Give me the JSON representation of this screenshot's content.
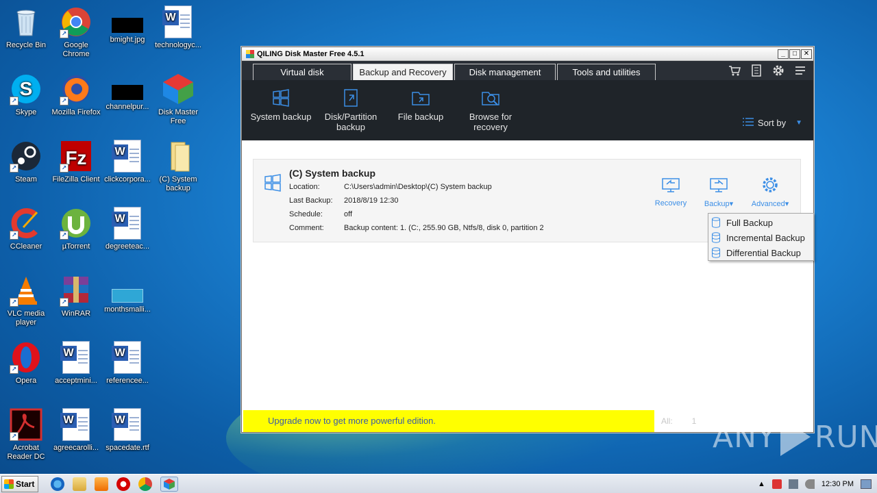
{
  "desktop": {
    "icons": [
      {
        "label": "Recycle Bin",
        "icon": "recycle-bin-icon"
      },
      {
        "label": "Google Chrome",
        "icon": "chrome-icon"
      },
      {
        "label": "bmight.jpg",
        "icon": "image-file-icon"
      },
      {
        "label": "technologyc...",
        "icon": "word-doc-icon"
      },
      {
        "label": "Skype",
        "icon": "skype-icon"
      },
      {
        "label": "Mozilla Firefox",
        "icon": "firefox-icon"
      },
      {
        "label": "channelpur...",
        "icon": "image-file-icon"
      },
      {
        "label": "Disk Master Free",
        "icon": "disk-master-icon"
      },
      {
        "label": "Steam",
        "icon": "steam-icon"
      },
      {
        "label": "FileZilla Client",
        "icon": "filezilla-icon"
      },
      {
        "label": "clickcorpora...",
        "icon": "word-doc-icon"
      },
      {
        "label": "(C) System backup",
        "icon": "folder-icon"
      },
      {
        "label": "CCleaner",
        "icon": "ccleaner-icon"
      },
      {
        "label": "µTorrent",
        "icon": "utorrent-icon"
      },
      {
        "label": "degreeteac...",
        "icon": "word-doc-icon"
      },
      {
        "label": "VLC media player",
        "icon": "vlc-icon"
      },
      {
        "label": "WinRAR",
        "icon": "winrar-icon"
      },
      {
        "label": "monthsmalli...",
        "icon": "image-file-icon"
      },
      {
        "label": "Opera",
        "icon": "opera-icon"
      },
      {
        "label": "acceptmini...",
        "icon": "word-doc-icon"
      },
      {
        "label": "referencee...",
        "icon": "word-doc-icon"
      },
      {
        "label": "Acrobat Reader DC",
        "icon": "acrobat-icon"
      },
      {
        "label": "agreecarolli...",
        "icon": "word-doc-icon"
      },
      {
        "label": "spacedate.rtf",
        "icon": "word-doc-icon"
      }
    ]
  },
  "window": {
    "title": "QILING Disk Master Free 4.5.1",
    "controls": {
      "minimize": "_",
      "maximize": "□",
      "close": "✕"
    }
  },
  "tabs": [
    {
      "label": "Virtual disk",
      "active": false
    },
    {
      "label": "Backup and Recovery",
      "active": true
    },
    {
      "label": "Disk management",
      "active": false
    },
    {
      "label": "Tools and utilities",
      "active": false
    }
  ],
  "toolbar": {
    "items": [
      {
        "label": "System backup",
        "icon": "windows-grid-icon"
      },
      {
        "label": "Disk/Partition backup",
        "icon": "disk-partition-icon"
      },
      {
        "label": "File backup",
        "icon": "folder-backup-icon"
      },
      {
        "label": "Browse for recovery",
        "icon": "browse-recovery-icon"
      }
    ],
    "sort_label": "Sort by"
  },
  "backup": {
    "title": "(C) System backup",
    "location_key": "Location:",
    "location_val": "C:\\Users\\admin\\Desktop\\(C) System backup",
    "last_key": "Last Backup:",
    "last_val": "2018/8/19 12:30",
    "schedule_key": "Schedule:",
    "schedule_val": "off",
    "comment_key": "Comment:",
    "comment_val": "Backup content:  1. (C:, 255.90 GB, Ntfs/8, disk 0, partition 2",
    "actions": {
      "recovery": "Recovery",
      "backup": "Backup▾",
      "advanced": "Advanced▾"
    }
  },
  "dropdown": {
    "items": [
      "Full Backup",
      "Incremental Backup",
      "Differential Backup"
    ]
  },
  "footer": {
    "upgrade": "Upgrade now to get more powerful edition.",
    "all_label": "All:",
    "all_count": "1"
  },
  "watermark": {
    "left": "ANY",
    "right": "RUN"
  },
  "taskbar": {
    "start": "Start",
    "clock": "12:30 PM"
  },
  "colors": {
    "accent": "#3b8ee6",
    "toolbar_bg": "#1f2429",
    "upgrade_bg": "#ffff00"
  }
}
